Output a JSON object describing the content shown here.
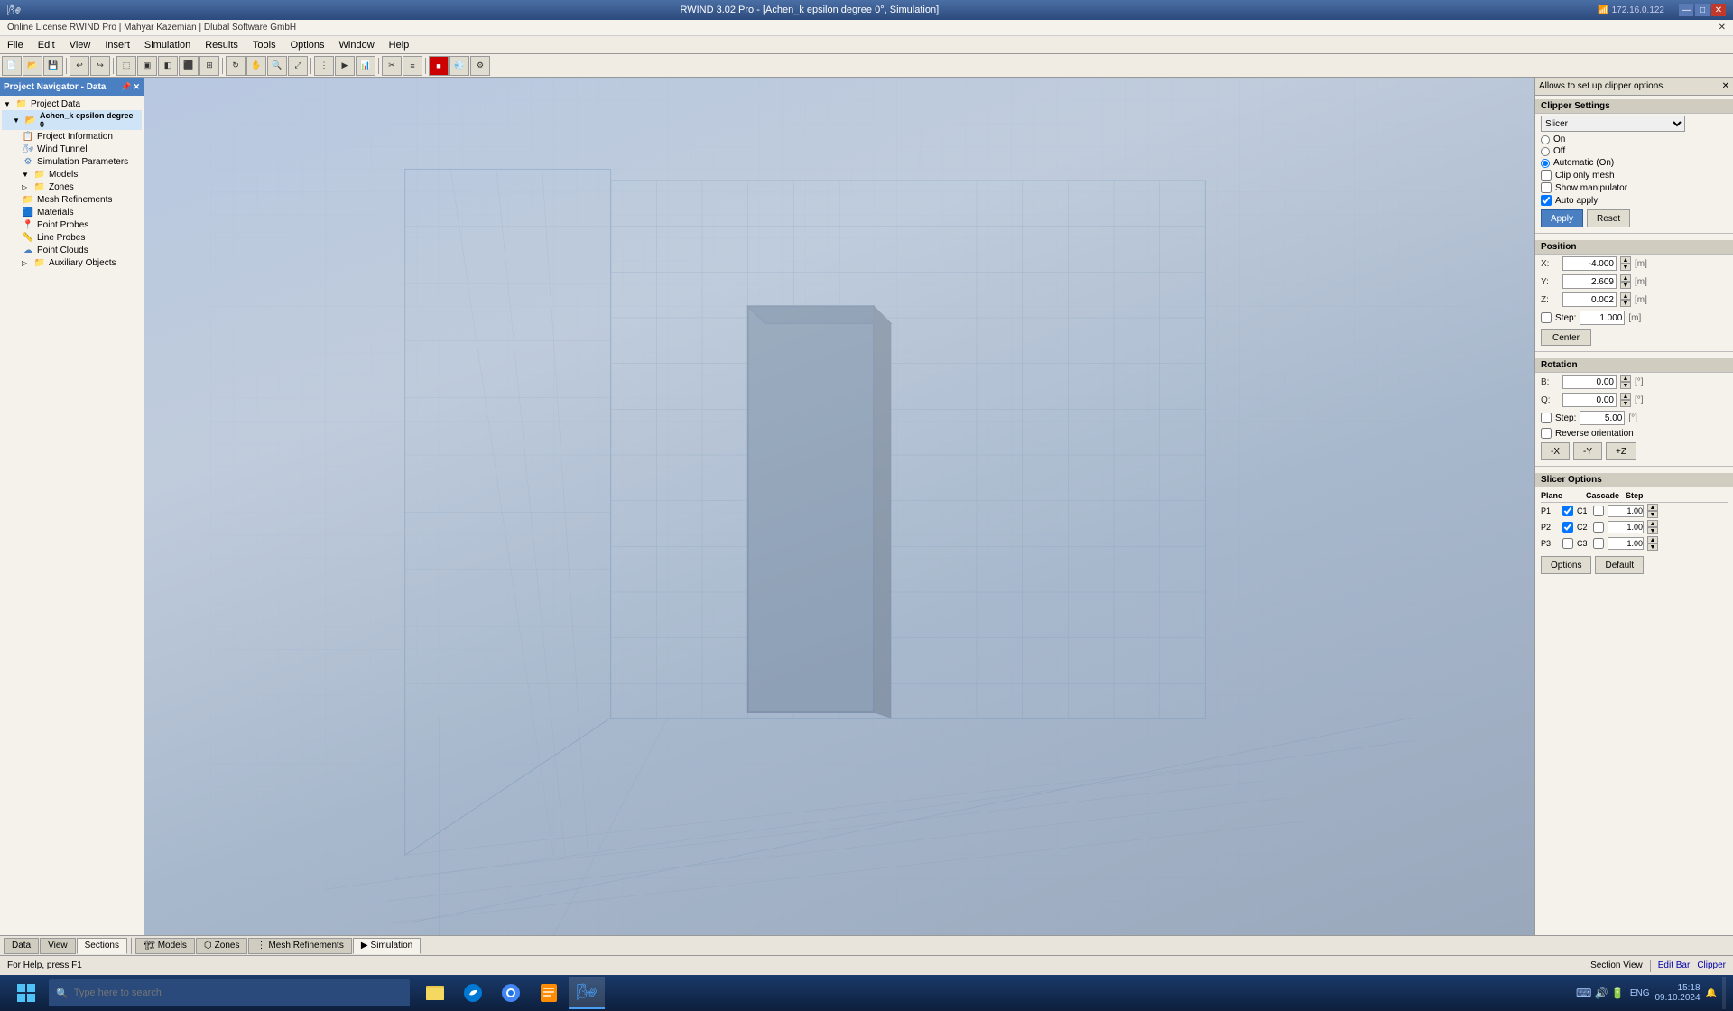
{
  "titlebar": {
    "title": "RWIND 3.02 Pro - [Achen_k epsilon degree 0°, Simulation]",
    "ip": "172.16.0.122",
    "controls": [
      "—",
      "□",
      "✕"
    ]
  },
  "license": {
    "text": "Online License RWIND Pro | Mahyar Kazemian | Dlubal Software GmbH"
  },
  "menu": {
    "items": [
      "File",
      "Edit",
      "View",
      "Insert",
      "Simulation",
      "Results",
      "Tools",
      "Options",
      "Window",
      "Help"
    ]
  },
  "navigator": {
    "title": "Project Navigator - Data",
    "tree": {
      "root": "Project Data",
      "project": "Achen_k epsilon degree 0",
      "items": [
        "Project Information",
        "Wind Tunnel",
        "Simulation Parameters",
        "Models",
        "Zones",
        "Mesh Refinements",
        "Materials",
        "Point Probes",
        "Line Probes",
        "Point Clouds",
        "Auxiliary Objects"
      ]
    }
  },
  "clipper": {
    "header": "Allows to set up clipper options.",
    "section_settings": "Clipper Settings",
    "dropdown_value": "Slicer",
    "radio_on": "On",
    "radio_off": "Off",
    "radio_auto": "Automatic (On)",
    "checkbox_clip_mesh": "Clip only mesh",
    "checkbox_manipulator": "Show manipulator",
    "checkbox_auto_apply": "Auto apply",
    "btn_apply": "Apply",
    "btn_reset": "Reset",
    "section_position": "Position",
    "pos_x_label": "X:",
    "pos_x_value": "-4.000",
    "pos_x_unit": "[m]",
    "pos_y_label": "Y:",
    "pos_y_value": "2.609",
    "pos_y_unit": "[m]",
    "pos_z_label": "Z:",
    "pos_z_value": "0.002",
    "pos_z_unit": "[m]",
    "checkbox_step": "Step:",
    "step_value": "1.000",
    "step_unit": "[m]",
    "btn_center": "Center",
    "section_rotation": "Rotation",
    "rot_b_label": "B:",
    "rot_b_value": "0.00",
    "rot_b_unit": "[°]",
    "rot_q_label": "Q:",
    "rot_q_value": "0.00",
    "rot_q_unit": "[°]",
    "checkbox_rot_step": "Step:",
    "rot_step_value": "5.00",
    "rot_step_unit": "[°]",
    "checkbox_reverse": "Reverse orientation",
    "btn_neg_x": "-X",
    "btn_neg_y": "-Y",
    "btn_pos_z": "+Z",
    "section_slicer": "Slicer Options",
    "slicer_headers": [
      "Plane",
      "Cascade",
      "Step"
    ],
    "slicer_rows": [
      {
        "plane": "P1",
        "cascade": "C1",
        "p_checked": true,
        "c_checked": false,
        "step": "1.00"
      },
      {
        "plane": "P2",
        "cascade": "C2",
        "p_checked": true,
        "c_checked": false,
        "step": "1.00"
      },
      {
        "plane": "P3",
        "cascade": "C3",
        "p_checked": false,
        "c_checked": false,
        "step": "1.00"
      }
    ],
    "btn_options": "Options",
    "btn_default": "Default"
  },
  "bottom_tabs": {
    "left_tabs": [
      "Data",
      "View",
      "Sections"
    ],
    "right_tabs": [
      "Models",
      "Zones",
      "Mesh Refinements",
      "Simulation"
    ],
    "active_left": "Sections",
    "active_right": "Simulation"
  },
  "statusbar": {
    "left": "For Help, press F1",
    "right": "Section View",
    "edit_bar": "Edit Bar",
    "clipper": "Clipper"
  },
  "taskbar": {
    "search_placeholder": "Type here to search",
    "time": "15:18",
    "date": "09.10.2024",
    "lang": "ENG"
  }
}
